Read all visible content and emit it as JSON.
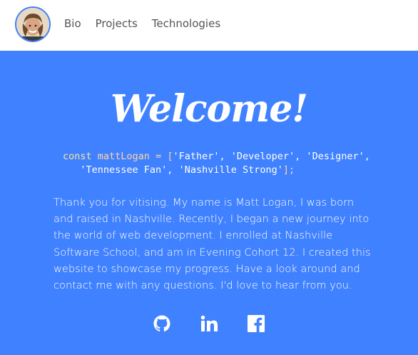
{
  "nav": {
    "links": [
      {
        "label": "Bio"
      },
      {
        "label": "Projects"
      },
      {
        "label": "Technologies"
      }
    ]
  },
  "hero": {
    "heading": "Welcome!",
    "code": {
      "keyword": "const",
      "variable": "mattLogan",
      "operator": "=",
      "open": "[",
      "line1_values": "'Father', 'Developer', 'Designer',",
      "line2_values": "'Tennessee Fan', 'Nashville Strong'",
      "close": "];"
    },
    "bio": "Thank you for vitising. My name is Matt Logan, I was born and raised in Nashville. Recently, I began a new journey into the world of web development. I enrolled at Nashville Software School, and am in Evening Cohort 12. I created this website to showcase my progress. Have a look around and contact me with any questions. I'd love to hear from you."
  },
  "social": {
    "icons": [
      "github-icon",
      "linkedin-icon",
      "facebook-icon"
    ]
  },
  "colors": {
    "accent": "#4081ff",
    "nav_text": "#555555",
    "code_keyword": "#f8e49b"
  }
}
